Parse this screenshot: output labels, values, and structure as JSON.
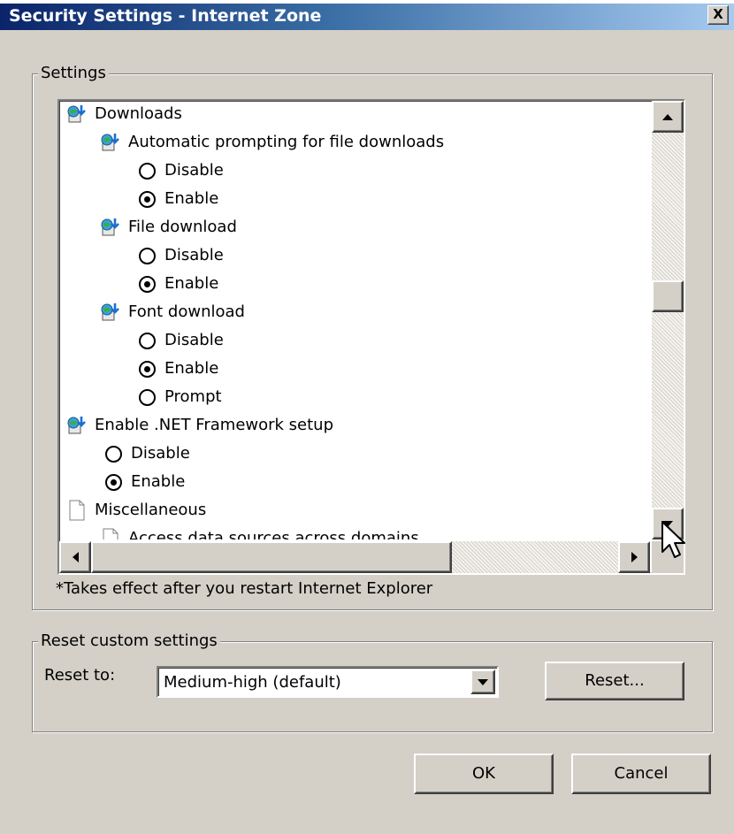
{
  "window": {
    "title": "Security Settings - Internet Zone",
    "close_label": "X"
  },
  "settings_group": {
    "legend": "Settings"
  },
  "tree": [
    {
      "type": "category",
      "label": "Downloads",
      "icon": "settings-globe-icon",
      "indent": 0
    },
    {
      "type": "setting",
      "label": "Automatic prompting for file downloads",
      "icon": "settings-globe-icon",
      "indent": 1
    },
    {
      "type": "option",
      "label": "Disable",
      "selected": false,
      "indent": 2
    },
    {
      "type": "option",
      "label": "Enable",
      "selected": true,
      "indent": 2
    },
    {
      "type": "setting",
      "label": "File download",
      "icon": "settings-globe-icon",
      "indent": 1
    },
    {
      "type": "option",
      "label": "Disable",
      "selected": false,
      "indent": 2
    },
    {
      "type": "option",
      "label": "Enable",
      "selected": true,
      "indent": 2
    },
    {
      "type": "setting",
      "label": "Font download",
      "icon": "settings-globe-icon",
      "indent": 1
    },
    {
      "type": "option",
      "label": "Disable",
      "selected": false,
      "indent": 2
    },
    {
      "type": "option",
      "label": "Enable",
      "selected": true,
      "indent": 2
    },
    {
      "type": "option",
      "label": "Prompt",
      "selected": false,
      "indent": 2
    },
    {
      "type": "category",
      "label": "Enable .NET Framework setup",
      "icon": "settings-globe-icon",
      "indent": 0
    },
    {
      "type": "option",
      "label": "Disable",
      "selected": false,
      "indent": 1
    },
    {
      "type": "option",
      "label": "Enable",
      "selected": true,
      "indent": 1
    },
    {
      "type": "category",
      "label": "Miscellaneous",
      "icon": "document-icon",
      "indent": 0
    },
    {
      "type": "setting",
      "label": "Access data sources across domains",
      "icon": "document-icon",
      "indent": 1
    }
  ],
  "scrollbars": {
    "vertical_position": 0.43,
    "horizontal_position": 0.0
  },
  "note": "*Takes effect after you restart Internet Explorer",
  "reset_group": {
    "legend": "Reset custom settings",
    "reset_to_label": "Reset to:",
    "selected_level": "Medium-high (default)",
    "reset_button": "Reset..."
  },
  "buttons": {
    "ok": "OK",
    "cancel": "Cancel"
  },
  "colors": {
    "title_start": "#0a246a",
    "title_end": "#a6caf0",
    "face": "#d4d0c8"
  }
}
